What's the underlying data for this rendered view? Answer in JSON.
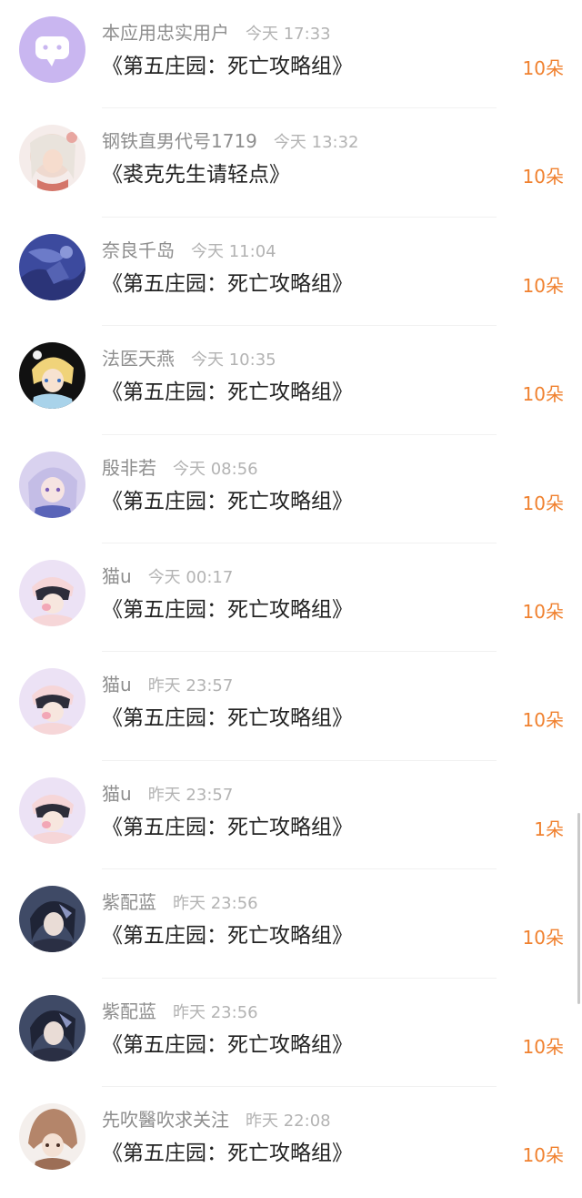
{
  "items": [
    {
      "user": "本应用忠实用户",
      "time": "今天 17:33",
      "title": "《第五庄园：死亡攻略组》",
      "count": "10朵",
      "avatar": "app-mascot-avatar"
    },
    {
      "user": "钢铁直男代号1719",
      "time": "今天 13:32",
      "title": "《裘克先生请轻点》",
      "count": "10朵",
      "avatar": "anime-girl-avatar"
    },
    {
      "user": "奈良千岛",
      "time": "今天 11:04",
      "title": "《第五庄园：死亡攻略组》",
      "count": "10朵",
      "avatar": "blue-scene-avatar"
    },
    {
      "user": "法医天燕",
      "time": "今天 10:35",
      "title": "《第五庄园：死亡攻略组》",
      "count": "10朵",
      "avatar": "blonde-character-avatar"
    },
    {
      "user": "殷非若",
      "time": "今天 08:56",
      "title": "《第五庄园：死亡攻略组》",
      "count": "10朵",
      "avatar": "silver-hair-girl-avatar"
    },
    {
      "user": "猫u",
      "time": "今天 00:17",
      "title": "《第五庄园：死亡攻略组》",
      "count": "10朵",
      "avatar": "pink-pig-boy-avatar"
    },
    {
      "user": "猫u",
      "time": "昨天 23:57",
      "title": "《第五庄园：死亡攻略组》",
      "count": "10朵",
      "avatar": "pink-pig-boy-avatar"
    },
    {
      "user": "猫u",
      "time": "昨天 23:57",
      "title": "《第五庄园：死亡攻略组》",
      "count": "1朵",
      "avatar": "pink-pig-boy-avatar"
    },
    {
      "user": "紫配蓝",
      "time": "昨天 23:56",
      "title": "《第五庄园：死亡攻略组》",
      "count": "10朵",
      "avatar": "dark-hair-man-avatar"
    },
    {
      "user": "紫配蓝",
      "time": "昨天 23:56",
      "title": "《第五庄园：死亡攻略组》",
      "count": "10朵",
      "avatar": "dark-hair-man-avatar"
    },
    {
      "user": "先吹醫吹求关注",
      "time": "昨天 22:08",
      "title": "《第五庄园：死亡攻略组》",
      "count": "10朵",
      "avatar": "hooded-character-avatar"
    }
  ],
  "colors": {
    "accent": "#f0812f",
    "username": "#8e8e8e",
    "time": "#b3b3b3",
    "title": "#222222"
  }
}
